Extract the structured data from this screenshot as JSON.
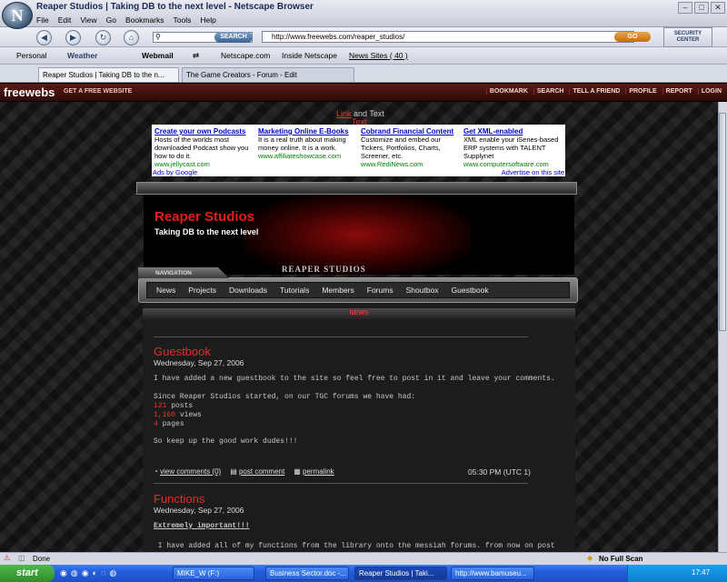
{
  "window": {
    "title": "Reaper Studios | Taking DB to the next level - Netscape Browser",
    "menu": [
      "File",
      "Edit",
      "View",
      "Go",
      "Bookmarks",
      "Tools",
      "Help"
    ]
  },
  "navbar": {
    "search_button": "SEARCH",
    "url": "http://www.freewebs.com/reaper_studios/",
    "go_label": "GO",
    "security_center": "SECURITY CENTER"
  },
  "personal_bar": {
    "personal": "Personal",
    "weather": "Weather",
    "webmail": "Webmail",
    "netscape": "Netscape.com",
    "inside_netscape": "Inside Netscape",
    "news_sites": "News Sites ( 40 )"
  },
  "tabs": [
    {
      "label": "Reaper Studios | Taking DB to the n..."
    },
    {
      "label": "The Game Creators - Forum - Edit"
    }
  ],
  "freewebs": {
    "logo": "freewebs",
    "get_site": "GET A FREE WEBSITE",
    "links": [
      "BOOKMARK",
      "SEARCH",
      "TELL A FRIEND",
      "PROFILE",
      "REPORT",
      "LOGIN"
    ]
  },
  "linktext": {
    "link": "Link",
    "and": "and Text",
    "text": "Text"
  },
  "ads": [
    {
      "title": "Create your own Podcasts",
      "body": "Hosts of the worlds most downloaded Podcast show you how to do it.",
      "url": "www.jellycast.com"
    },
    {
      "title": "Marketing Online E-Books",
      "body": "It is a real truth about making money online. It is a work.",
      "url": "www.affiliateshowcase.com"
    },
    {
      "title": "Cobrand Financial Content",
      "body": "Customize and embed our Tickers, Portfolios, Charts, Screener, etc.",
      "url": "www.RediNews.com"
    },
    {
      "title": "Get XML-enabled",
      "body": "XML enable your iSeries-based ERP systems with TALENT Supplynet",
      "url": "www.computersoftware.com"
    }
  ],
  "ads_by": "Ads by Google",
  "ads_advertise": "Advertise on this site",
  "site": {
    "name": "Reaper Studios",
    "tagline": "Taking DB to the next level",
    "watermark": "REAPER STUDIOS",
    "nav_label": "NAVIGATION",
    "nav": [
      "News",
      "Projects",
      "Downloads",
      "Tutorials",
      "Members",
      "Forums",
      "Shoutbox",
      "Guestbook"
    ],
    "section": "NEWS"
  },
  "posts": [
    {
      "title": "Guestbook",
      "date": "Wednesday, Sep 27, 2006",
      "line1": "I have added a new guestbook to the site so feel free to post in it and leave your comments.",
      "line2": "Since Reaper Studios started, on our TGC forums we have had:",
      "posts_num": "121",
      "posts_label": " posts",
      "views_num": "1,160",
      "views_label": " views",
      "pages_num": "4",
      "pages_label": " pages",
      "line3": "So keep up the good work dudes!!!",
      "view_comments": "view comments (0)",
      "post_comment": "post comment",
      "permalink": "permalink",
      "time": "05:30 PM (UTC 1)"
    },
    {
      "title": "Functions",
      "date": "Wednesday, Sep 27, 2006",
      "line1": "Extremely important!!!",
      "line2": " I have added all of my functions from the library onto the messiah forums. from now on post"
    }
  ],
  "status": {
    "text": "Done",
    "scan": "No Full Scan"
  },
  "taskbar": {
    "start": "start",
    "items": [
      "MIKE_W (F:)",
      "Business Sector.doc -...",
      "Reaper Studios | Taki...",
      "http://www.bamuseu..."
    ],
    "clock": "17:47"
  }
}
